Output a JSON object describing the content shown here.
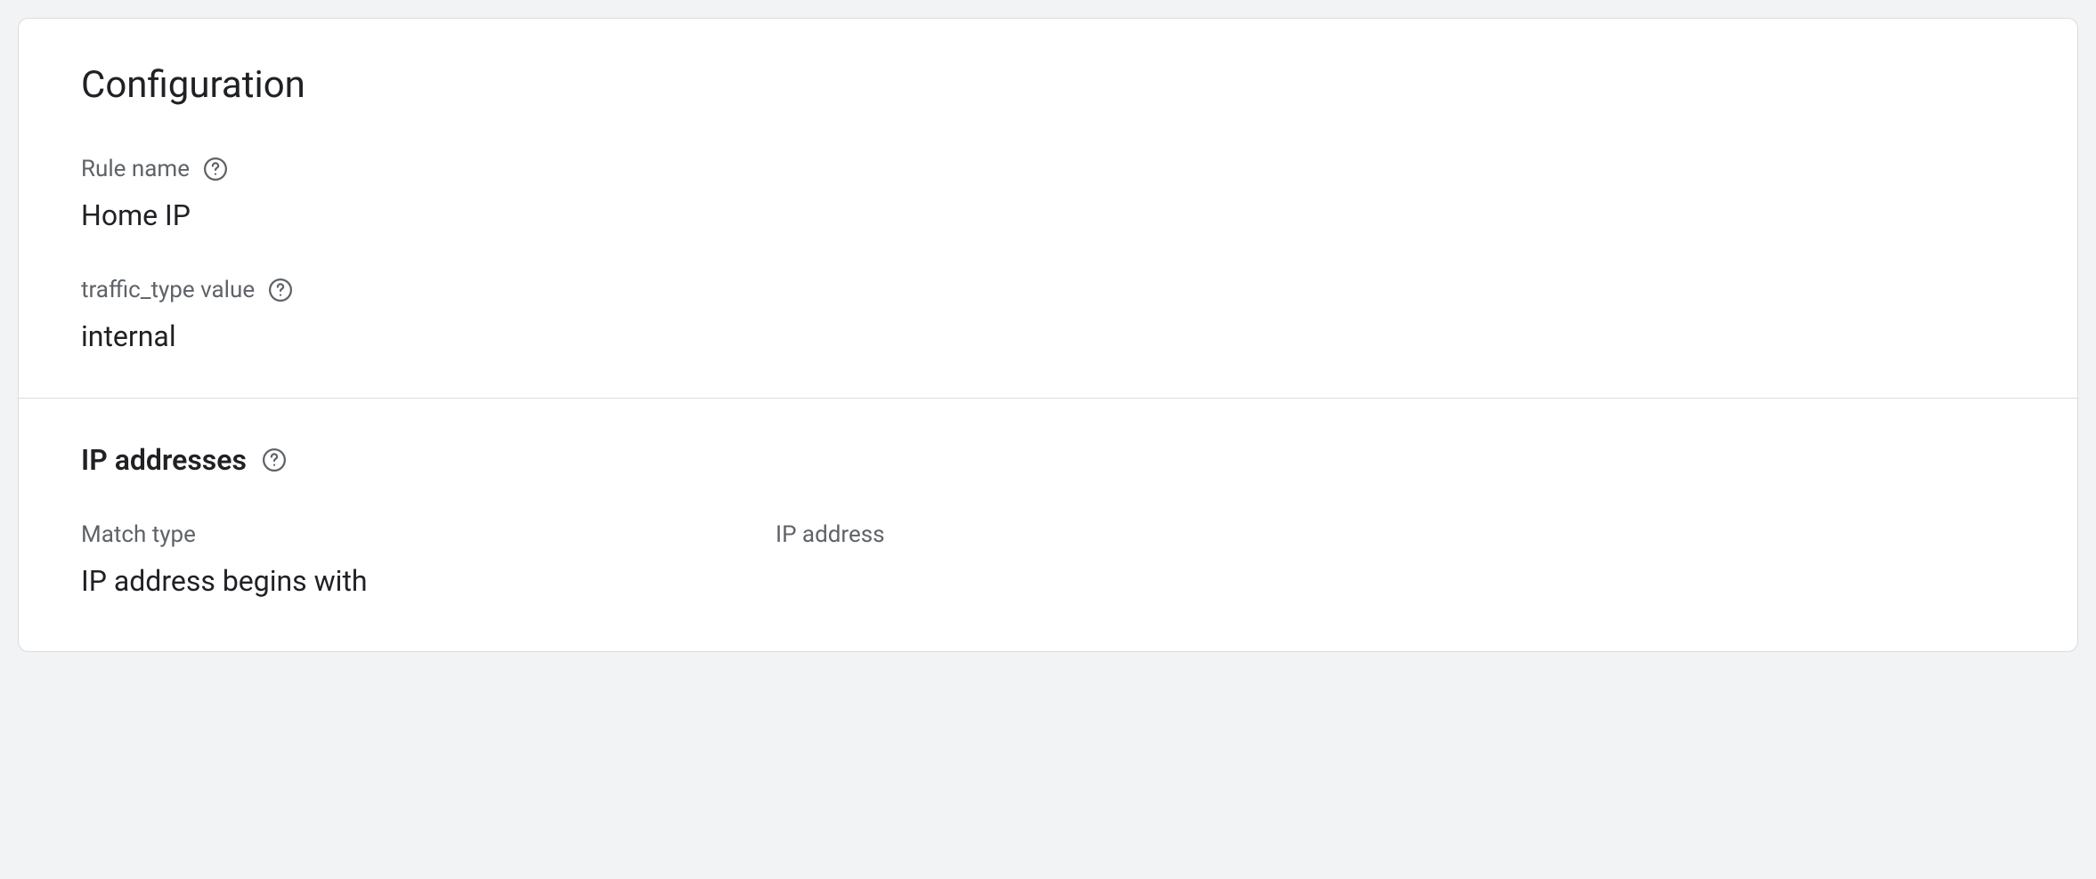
{
  "card": {
    "title": "Configuration",
    "rule_name": {
      "label": "Rule name",
      "value": "Home IP"
    },
    "traffic_type": {
      "label": "traffic_type value",
      "value": "internal"
    },
    "ip_section": {
      "heading": "IP addresses",
      "match_type": {
        "label": "Match type",
        "value": "IP address begins with"
      },
      "ip_address": {
        "label": "IP address",
        "value": ""
      }
    }
  }
}
